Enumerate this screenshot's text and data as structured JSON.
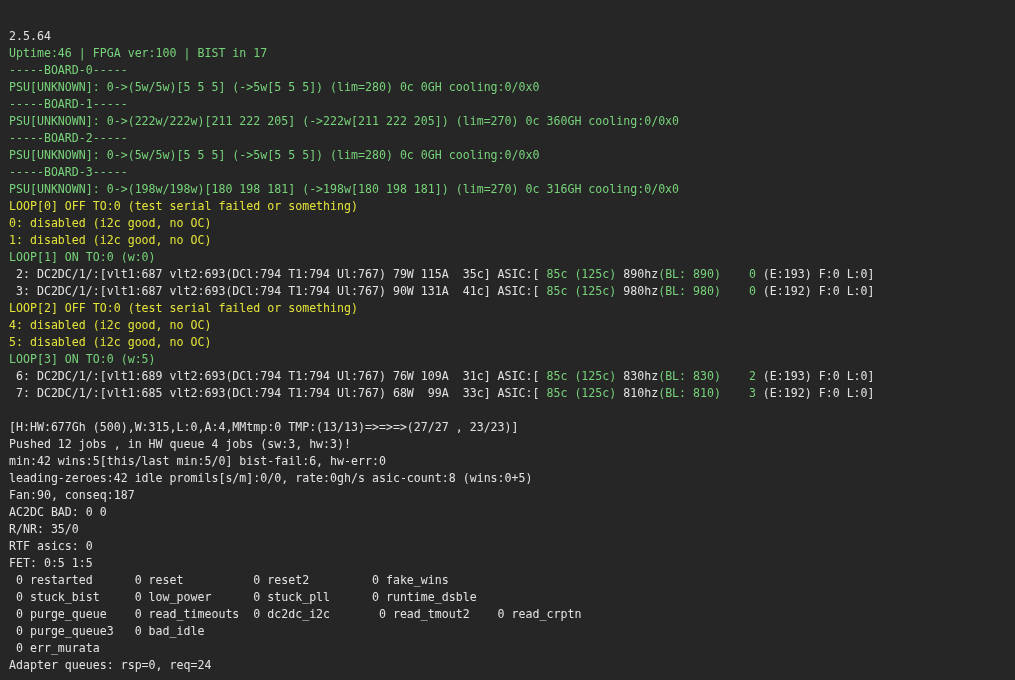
{
  "console": {
    "blocks": [
      {
        "lines": [
          {
            "segments": [
              {
                "text": "2.5.64",
                "kind": "normal"
              }
            ]
          },
          {
            "segments": [
              {
                "text": "Uptime:46 | FPGA ver:100 | BIST in 17",
                "kind": "good"
              }
            ]
          },
          {
            "segments": [
              {
                "text": "-----BOARD-0-----",
                "kind": "good"
              }
            ]
          },
          {
            "segments": [
              {
                "text": "PSU[UNKNOWN]: 0->(5w/5w)[5 5 5] (->5w[5 5 5]) (lim=280) 0c 0GH cooling:0/0x0",
                "kind": "good"
              }
            ]
          },
          {
            "segments": [
              {
                "text": "-----BOARD-1-----",
                "kind": "good"
              }
            ]
          },
          {
            "segments": [
              {
                "text": "PSU[UNKNOWN]: 0->(222w/222w)[211 222 205] (->222w[211 222 205]) (lim=270) 0c 360GH cooling:0/0x0",
                "kind": "good"
              }
            ]
          },
          {
            "segments": [
              {
                "text": "-----BOARD-2-----",
                "kind": "good"
              }
            ]
          },
          {
            "segments": [
              {
                "text": "PSU[UNKNOWN]: 0->(5w/5w)[5 5 5] (->5w[5 5 5]) (lim=280) 0c 0GH cooling:0/0x0",
                "kind": "good"
              }
            ]
          },
          {
            "segments": [
              {
                "text": "-----BOARD-3-----",
                "kind": "good"
              }
            ]
          },
          {
            "segments": [
              {
                "text": "PSU[UNKNOWN]: 0->(198w/198w)[180 198 181] (->198w[180 198 181]) (lim=270) 0c 316GH cooling:0/0x0",
                "kind": "good"
              }
            ]
          },
          {
            "segments": [
              {
                "text": "LOOP[0] OFF TO:0 (test serial failed or something)",
                "kind": "warning"
              }
            ]
          },
          {
            "segments": [
              {
                "text": "0: disabled (i2c good, no OC)",
                "kind": "warning"
              }
            ]
          },
          {
            "segments": [
              {
                "text": "1: disabled (i2c good, no OC)",
                "kind": "warning"
              }
            ]
          },
          {
            "segments": [
              {
                "text": "LOOP[1] ON TO:0 (w:0)",
                "kind": "good"
              }
            ]
          },
          {
            "segments": [
              {
                "text": " 2: DC2DC/1/:[vlt1:687 vlt2:693(DCl:794 T1:794 Ul:767) 79W 115A  35c] ASIC:[",
                "kind": "normal"
              },
              {
                "text": " 85c (125c)",
                "kind": "good"
              },
              {
                "text": " 890hz",
                "kind": "normal"
              },
              {
                "text": "(BL: 890)    0",
                "kind": "good"
              },
              {
                "text": " (E:193) F:0 L:0]",
                "kind": "normal"
              }
            ]
          },
          {
            "segments": [
              {
                "text": " 3: DC2DC/1/:[vlt1:687 vlt2:693(DCl:794 T1:794 Ul:767) 90W 131A  41c] ASIC:[",
                "kind": "normal"
              },
              {
                "text": " 85c (125c)",
                "kind": "good"
              },
              {
                "text": " 980hz",
                "kind": "normal"
              },
              {
                "text": "(BL: 980)    0",
                "kind": "good"
              },
              {
                "text": " (E:192) F:0 L:0]",
                "kind": "normal"
              }
            ]
          },
          {
            "segments": [
              {
                "text": "LOOP[2] OFF TO:0 (test serial failed or something)",
                "kind": "warning"
              }
            ]
          },
          {
            "segments": [
              {
                "text": "4: disabled (i2c good, no OC)",
                "kind": "warning"
              }
            ]
          },
          {
            "segments": [
              {
                "text": "5: disabled (i2c good, no OC)",
                "kind": "warning"
              }
            ]
          },
          {
            "segments": [
              {
                "text": "LOOP[3] ON TO:0 (w:5)",
                "kind": "good"
              }
            ]
          },
          {
            "segments": [
              {
                "text": " 6: DC2DC/1/:[vlt1:689 vlt2:693(DCl:794 T1:794 Ul:767) 76W 109A  31c] ASIC:[",
                "kind": "normal"
              },
              {
                "text": " 85c (125c)",
                "kind": "good"
              },
              {
                "text": " 830hz",
                "kind": "normal"
              },
              {
                "text": "(BL: 830)    2",
                "kind": "good"
              },
              {
                "text": " (E:193) F:0 L:0]",
                "kind": "normal"
              }
            ]
          },
          {
            "segments": [
              {
                "text": " 7: DC2DC/1/:[vlt1:685 vlt2:693(DCl:794 T1:794 Ul:767) 68W  99A  33c] ASIC:[",
                "kind": "normal"
              },
              {
                "text": " 85c (125c)",
                "kind": "good"
              },
              {
                "text": " 810hz",
                "kind": "normal"
              },
              {
                "text": "(BL: 810)    3",
                "kind": "good"
              },
              {
                "text": " (E:192) F:0 L:0]",
                "kind": "normal"
              }
            ]
          }
        ]
      },
      {
        "lines": [
          {
            "segments": [
              {
                "text": "[H:HW:677Gh (500),W:315,L:0,A:4,MMtmp:0 TMP:(13/13)=>=>=>(27/27 , 23/23)]",
                "kind": "normal"
              }
            ]
          },
          {
            "segments": [
              {
                "text": "Pushed 12 jobs , in HW queue 4 jobs (sw:3, hw:3)!",
                "kind": "normal"
              }
            ]
          },
          {
            "segments": [
              {
                "text": "min:42 wins:5[this/last min:5/0] bist-fail:6, hw-err:0",
                "kind": "normal"
              }
            ]
          },
          {
            "segments": [
              {
                "text": "leading-zeroes:42 idle promils[s/m]:0/0, rate:0gh/s asic-count:8 (wins:0+5)",
                "kind": "normal"
              }
            ]
          },
          {
            "segments": [
              {
                "text": "Fan:90, conseq:187",
                "kind": "normal"
              }
            ]
          },
          {
            "segments": [
              {
                "text": "AC2DC BAD: 0 0",
                "kind": "normal"
              }
            ]
          },
          {
            "segments": [
              {
                "text": "R/NR: 35/0",
                "kind": "normal"
              }
            ]
          },
          {
            "segments": [
              {
                "text": "RTF asics: 0",
                "kind": "normal"
              }
            ]
          },
          {
            "segments": [
              {
                "text": "FET: 0:5 1:5",
                "kind": "normal"
              }
            ]
          },
          {
            "segments": [
              {
                "text": " 0 restarted      0 reset          0 reset2         0 fake_wins",
                "kind": "normal"
              }
            ]
          },
          {
            "segments": [
              {
                "text": " 0 stuck_bist     0 low_power      0 stuck_pll      0 runtime_dsble",
                "kind": "normal"
              }
            ]
          },
          {
            "segments": [
              {
                "text": " 0 purge_queue    0 read_timeouts  0 dc2dc_i2c       0 read_tmout2    0 read_crptn",
                "kind": "normal"
              }
            ]
          },
          {
            "segments": [
              {
                "text": " 0 purge_queue3   0 bad_idle",
                "kind": "normal"
              }
            ]
          },
          {
            "segments": [
              {
                "text": " 0 err_murata",
                "kind": "normal"
              }
            ]
          },
          {
            "segments": [
              {
                "text": "Adapter queues: rsp=0, req=24",
                "kind": "normal"
              }
            ]
          }
        ]
      }
    ]
  }
}
